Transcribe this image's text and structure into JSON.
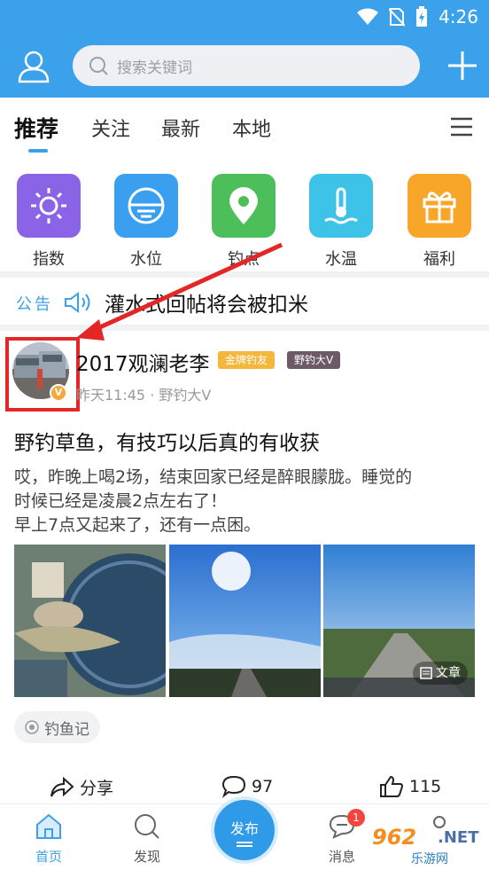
{
  "status_bar": {
    "time": "4:26"
  },
  "header": {
    "search_placeholder": "搜索关键词"
  },
  "tabs": [
    {
      "label": "推荐",
      "active": true
    },
    {
      "label": "关注",
      "active": false
    },
    {
      "label": "最新",
      "active": false
    },
    {
      "label": "本地",
      "active": false
    }
  ],
  "quick_links": [
    {
      "label": "指数",
      "icon": "sun-icon",
      "color": "#8a63e6"
    },
    {
      "label": "水位",
      "icon": "water-level-icon",
      "color": "#3b9ff0"
    },
    {
      "label": "钓点",
      "icon": "location-pin-icon",
      "color": "#4cbf5b"
    },
    {
      "label": "水温",
      "icon": "thermometer-icon",
      "color": "#3dc3e8"
    },
    {
      "label": "福利",
      "icon": "gift-icon",
      "color": "#f7a629"
    }
  ],
  "notice": {
    "tag": "公告",
    "text": "灌水式回帖将会被扣米"
  },
  "post": {
    "username": "2017观澜老李",
    "badges": [
      "金牌钓友",
      "野钓大V"
    ],
    "meta": "昨天11:45 · 野钓大V",
    "verified_mark": "V",
    "title": "野钓草鱼，有技巧以后真的有收获",
    "body_lines": [
      "哎，昨晚上喝2场，结束回家已经是醉眼朦胧。睡觉的",
      "时候已经是凌晨2点左右了！",
      "早上7点又起来了，还有一点困。"
    ],
    "article_tag": "文章",
    "topic": "钓鱼记",
    "actions": {
      "share": "分享",
      "comments": "97",
      "likes": "115"
    }
  },
  "bottom_nav": {
    "home": "首页",
    "discover": "发现",
    "publish": "发布",
    "messages": "消息",
    "message_badge": "1"
  },
  "watermark": {
    "number": "962",
    "suffix": ".NET",
    "site": "乐游网"
  },
  "colors": {
    "brand": "#3aa1ea",
    "highlight": "#e32626"
  }
}
